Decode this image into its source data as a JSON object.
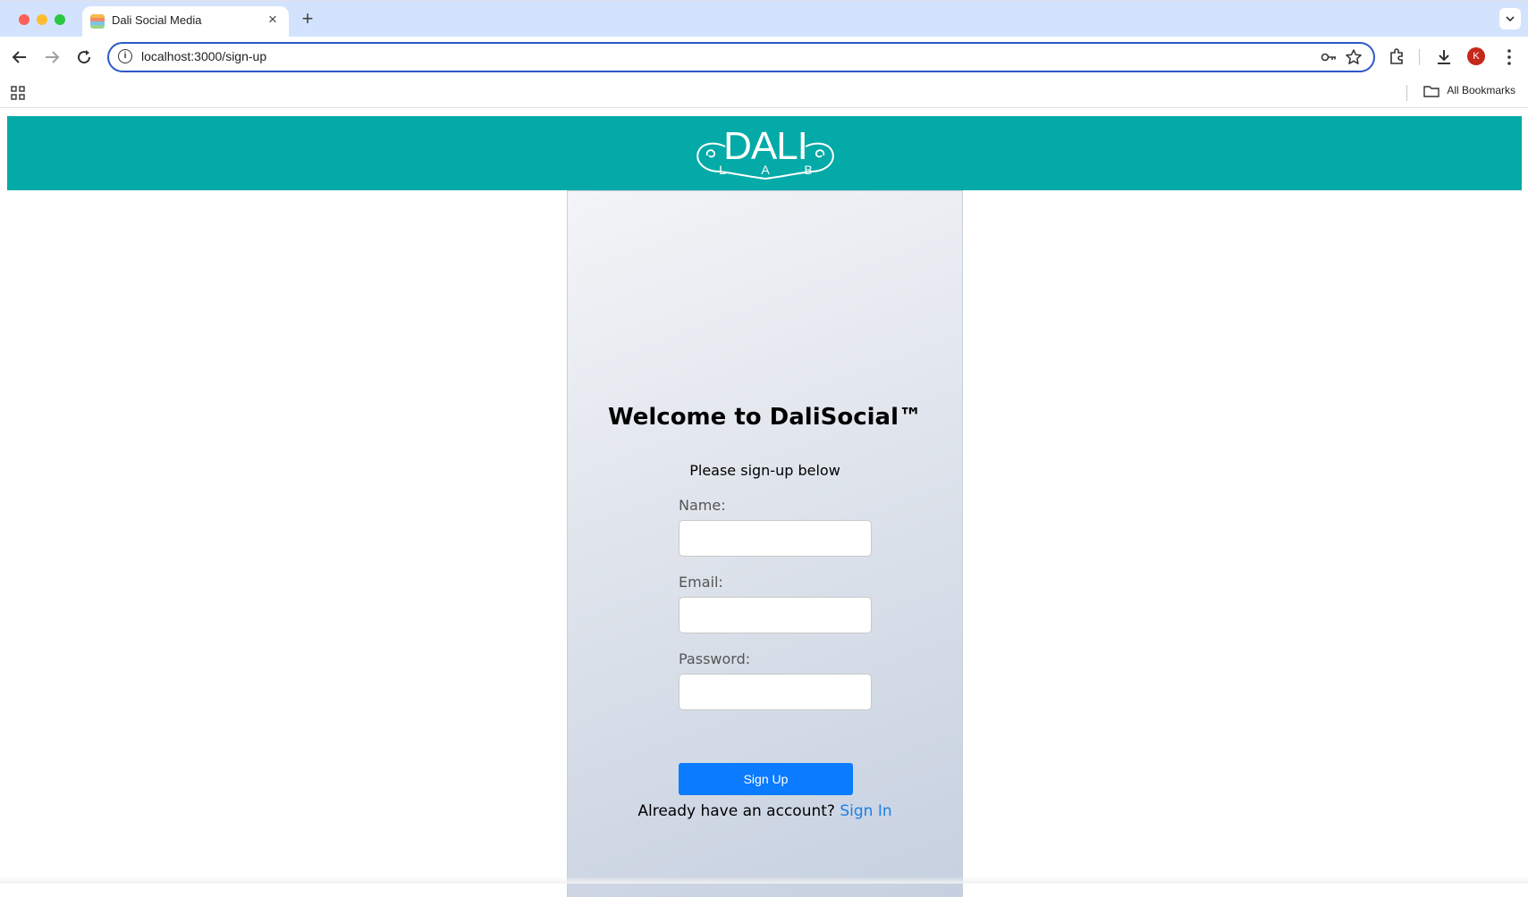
{
  "browser": {
    "tab": {
      "title": "Dali Social Media",
      "close": "×"
    },
    "new_tab": "+",
    "url": {
      "host": "localhost",
      "rest": ":3000/sign-up"
    },
    "profile_initial": "K",
    "bookmarks": {
      "all_label": "All Bookmarks"
    }
  },
  "header": {
    "logo": {
      "main_text": "DALI",
      "sub_letters": [
        "L",
        "A",
        "B"
      ]
    }
  },
  "signup": {
    "title": "Welcome to DaliSocial™",
    "subtitle": "Please sign-up below",
    "name_label": "Name:",
    "name_value": "",
    "email_label": "Email:",
    "email_value": "",
    "password_label": "Password:",
    "password_value": "",
    "button_label": "Sign Up",
    "signin_prompt": "Already have an account?",
    "signin_link": "Sign In"
  },
  "colors": {
    "header_teal": "#03aaa8",
    "primary_button": "#0b7bff",
    "link": "#1a7fe6",
    "omnibox_focus": "#2c58c7",
    "tabstrip": "#d3e3fd"
  }
}
